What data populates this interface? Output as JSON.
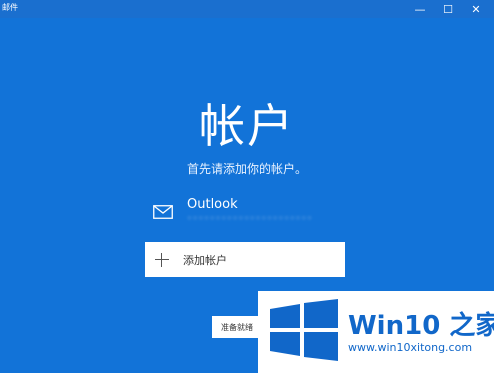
{
  "window": {
    "title": "邮件",
    "minimize_glyph": "—",
    "maximize_glyph": "☐",
    "close_glyph": "✕"
  },
  "main": {
    "heading": "帐户",
    "subheading": "首先请添加你的帐户。",
    "account": {
      "icon": "mail-icon",
      "name": "Outlook",
      "email": "••••••••••••••••••••••"
    },
    "add_account_label": "添加帐户",
    "ready_button_label": "准备就绪"
  },
  "watermark": {
    "title": "Win10 之家",
    "url": "www.win10xitong.com"
  },
  "colors": {
    "background": "#1273d8",
    "watermark_blue": "#1167c9"
  }
}
